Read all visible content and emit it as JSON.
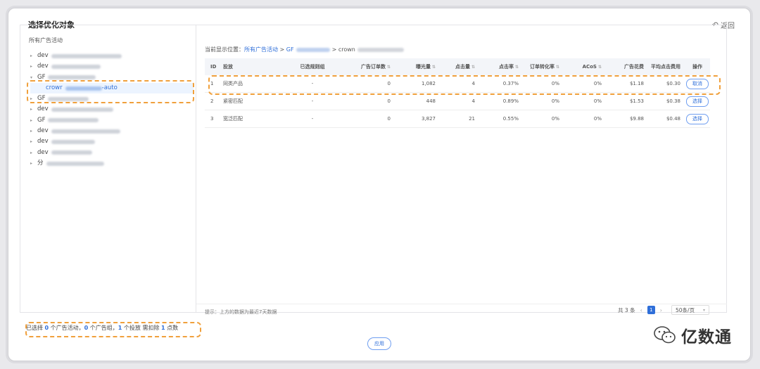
{
  "header": {
    "title": "选择优化对象",
    "back_label": "返回"
  },
  "tree": {
    "heading": "所有广告活动",
    "items": [
      {
        "prefix": "dev",
        "blur": 100,
        "caret": "▸"
      },
      {
        "prefix": "dev",
        "blur": 70,
        "caret": "▸"
      },
      {
        "prefix": "GF",
        "blur": 68,
        "caret": "▾"
      },
      {
        "prefix": "crowr",
        "suffix": "-auto",
        "blur": 52,
        "caret": "",
        "child": true
      },
      {
        "prefix": "GF",
        "blur": 58,
        "caret": "▸"
      },
      {
        "prefix": "dev",
        "blur": 88,
        "caret": "▸"
      },
      {
        "prefix": "GF",
        "blur": 72,
        "caret": "▸"
      },
      {
        "prefix": "dev",
        "blur": 98,
        "caret": "▸"
      },
      {
        "prefix": "dev",
        "blur": 62,
        "caret": "▸"
      },
      {
        "prefix": "dev",
        "blur": 58,
        "caret": "▸"
      },
      {
        "prefix": "分",
        "blur": 82,
        "caret": "▸"
      }
    ]
  },
  "crumb": {
    "label": "当前显示位置：",
    "root": "所有广告活动",
    "gf": "GF",
    "crown": "crown"
  },
  "table": {
    "headers": {
      "id": "ID",
      "name": "投放",
      "grp": "已选规则组",
      "ord": "广告订单数",
      "imp": "曝光量",
      "clk": "点击量",
      "ctr": "点击率",
      "cvr": "订单转化率",
      "acos": "ACoS",
      "cost": "广告花费",
      "cpc": "平均点击费用",
      "op": "操作"
    },
    "rows": [
      {
        "id": "1",
        "name": "同类产品",
        "grp": "-",
        "ord": "0",
        "imp": "1,082",
        "clk": "4",
        "ctr": "0.37%",
        "cvr": "0%",
        "acos": "0%",
        "cost": "$1.18",
        "cpc": "$0.30",
        "op": "取消"
      },
      {
        "id": "2",
        "name": "紧密匹配",
        "grp": "-",
        "ord": "0",
        "imp": "448",
        "clk": "4",
        "ctr": "0.89%",
        "cvr": "0%",
        "acos": "0%",
        "cost": "$1.53",
        "cpc": "$0.38",
        "op": "选择"
      },
      {
        "id": "3",
        "name": "宽泛匹配",
        "grp": "-",
        "ord": "0",
        "imp": "3,827",
        "clk": "21",
        "ctr": "0.55%",
        "cvr": "0%",
        "acos": "0%",
        "cost": "$9.88",
        "cpc": "$0.48",
        "op": "选择"
      }
    ]
  },
  "footer": {
    "hint": "提示：上方的数据为最近7天数据",
    "total": "共 3 条",
    "page": "1",
    "page_size": "50条/页"
  },
  "summary": {
    "p1": "已选择 ",
    "n1": "0",
    "p2": " 个广告活动，",
    "n2": "0",
    "p3": " 个广告组，",
    "n3": "1",
    "p4": " 个投放 需扣除 ",
    "n4": "1",
    "p5": " 点数"
  },
  "apply_label": "应用",
  "watermark": "亿数通"
}
